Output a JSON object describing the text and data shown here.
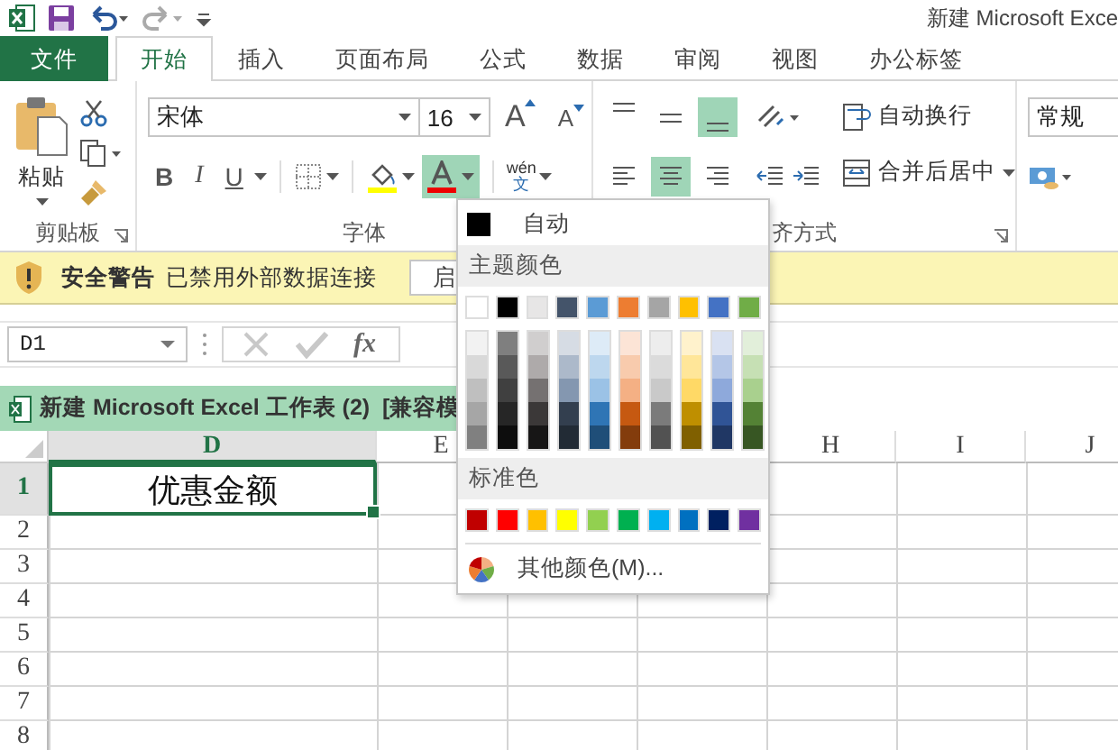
{
  "window": {
    "title": "新建 Microsoft Exce"
  },
  "tabs": [
    {
      "label": "文件",
      "kind": "file",
      "selected": false
    },
    {
      "label": "开始",
      "kind": "tab",
      "selected": true
    },
    {
      "label": "插入",
      "kind": "tab",
      "selected": false
    },
    {
      "label": "页面布局",
      "kind": "tab",
      "selected": false
    },
    {
      "label": "公式",
      "kind": "tab",
      "selected": false
    },
    {
      "label": "数据",
      "kind": "tab",
      "selected": false
    },
    {
      "label": "审阅",
      "kind": "tab",
      "selected": false
    },
    {
      "label": "视图",
      "kind": "tab",
      "selected": false
    },
    {
      "label": "办公标签",
      "kind": "tab",
      "selected": false
    }
  ],
  "ribbon": {
    "clipboard": {
      "paste_label": "粘贴",
      "group_label": "剪贴板"
    },
    "font": {
      "font_name": "宋体",
      "font_size": "16",
      "grow_label": "A",
      "shrink_label": "A",
      "bold_label": "B",
      "italic_label": "I",
      "underline_label": "U",
      "phonetic_top": "wén",
      "phonetic_bottom": "文",
      "font_color_on": true,
      "group_label": "字体"
    },
    "alignment": {
      "vertical": [
        {
          "kind": "top",
          "on": false
        },
        {
          "kind": "middle",
          "on": false
        },
        {
          "kind": "bottom",
          "on": true
        }
      ],
      "horizontal": [
        {
          "kind": "left",
          "on": false
        },
        {
          "kind": "center",
          "on": true
        },
        {
          "kind": "right",
          "on": false
        }
      ],
      "wrap_label": "自动换行",
      "merge_label": "合并后居中",
      "group_label": "齐方式"
    },
    "number": {
      "format": "常规"
    }
  },
  "security_bar": {
    "title": "安全警告",
    "message": "已禁用外部数据连接",
    "button": "启"
  },
  "formula_bar": {
    "name_box": "D1",
    "fx": "fx"
  },
  "workbook": {
    "title": "新建 Microsoft Excel 工作表 (2)  [兼容模"
  },
  "sheet": {
    "columns": [
      {
        "label": "D",
        "selected": true
      },
      {
        "label": "E",
        "selected": false
      },
      {
        "label": "H",
        "selected": false
      },
      {
        "label": "I",
        "selected": false
      },
      {
        "label": "J",
        "selected": false
      }
    ],
    "rows": [
      {
        "label": "1",
        "selected": true,
        "cells": [
          {
            "text": "优惠金额",
            "selected": true
          }
        ]
      },
      {
        "label": "2",
        "selected": false
      },
      {
        "label": "3",
        "selected": false
      },
      {
        "label": "4",
        "selected": false
      },
      {
        "label": "5",
        "selected": false
      },
      {
        "label": "6",
        "selected": false
      },
      {
        "label": "7",
        "selected": false
      },
      {
        "label": "8",
        "selected": false
      }
    ]
  },
  "color_menu": {
    "automatic": {
      "label": "自动",
      "color": "#000000"
    },
    "theme_heading": "主题颜色",
    "theme_colors": [
      {
        "color": "#ffffff",
        "shades": [
          {
            "color": "#f2f2f2"
          },
          {
            "color": "#d9d9d9"
          },
          {
            "color": "#bfbfbf"
          },
          {
            "color": "#a6a6a6"
          },
          {
            "color": "#808080"
          }
        ]
      },
      {
        "color": "#000000",
        "shades": [
          {
            "color": "#7f7f7f"
          },
          {
            "color": "#595959"
          },
          {
            "color": "#404040"
          },
          {
            "color": "#262626"
          },
          {
            "color": "#0d0d0d"
          }
        ]
      },
      {
        "color": "#e7e6e6",
        "shades": [
          {
            "color": "#d0cece"
          },
          {
            "color": "#aeaaaa"
          },
          {
            "color": "#757171"
          },
          {
            "color": "#3b3838"
          },
          {
            "color": "#171616"
          }
        ]
      },
      {
        "color": "#44546a",
        "shades": [
          {
            "color": "#d6dce4"
          },
          {
            "color": "#acb9ca"
          },
          {
            "color": "#8497b0"
          },
          {
            "color": "#333f4f"
          },
          {
            "color": "#222b35"
          }
        ]
      },
      {
        "color": "#5b9bd5",
        "shades": [
          {
            "color": "#ddebf7"
          },
          {
            "color": "#bdd7ee"
          },
          {
            "color": "#9bc2e6"
          },
          {
            "color": "#2f75b5"
          },
          {
            "color": "#1f4e78"
          }
        ]
      },
      {
        "color": "#ed7d31",
        "shades": [
          {
            "color": "#fce4d6"
          },
          {
            "color": "#f8cbad"
          },
          {
            "color": "#f4b084"
          },
          {
            "color": "#c65911"
          },
          {
            "color": "#833c0c"
          }
        ]
      },
      {
        "color": "#a5a5a5",
        "shades": [
          {
            "color": "#ededed"
          },
          {
            "color": "#dbdbdb"
          },
          {
            "color": "#c9c9c9"
          },
          {
            "color": "#7b7b7b"
          },
          {
            "color": "#525252"
          }
        ]
      },
      {
        "color": "#ffc000",
        "shades": [
          {
            "color": "#fff2cc"
          },
          {
            "color": "#ffe699"
          },
          {
            "color": "#ffd966"
          },
          {
            "color": "#bf8f00"
          },
          {
            "color": "#806000"
          }
        ]
      },
      {
        "color": "#4472c4",
        "shades": [
          {
            "color": "#d9e1f2"
          },
          {
            "color": "#b4c6e7"
          },
          {
            "color": "#8ea9db"
          },
          {
            "color": "#305496"
          },
          {
            "color": "#203764"
          }
        ]
      },
      {
        "color": "#70ad47",
        "shades": [
          {
            "color": "#e2efda"
          },
          {
            "color": "#c6e0b4"
          },
          {
            "color": "#a9d08e"
          },
          {
            "color": "#548235"
          },
          {
            "color": "#375623"
          }
        ]
      }
    ],
    "standard_heading": "标准色",
    "standard_colors": [
      {
        "color": "#c00000"
      },
      {
        "color": "#ff0000"
      },
      {
        "color": "#ffc000"
      },
      {
        "color": "#ffff00"
      },
      {
        "color": "#92d050"
      },
      {
        "color": "#00b050"
      },
      {
        "color": "#00b0f0"
      },
      {
        "color": "#0070c0"
      },
      {
        "color": "#002060"
      },
      {
        "color": "#7030a0"
      }
    ],
    "more_label": "其他颜色(M)..."
  }
}
